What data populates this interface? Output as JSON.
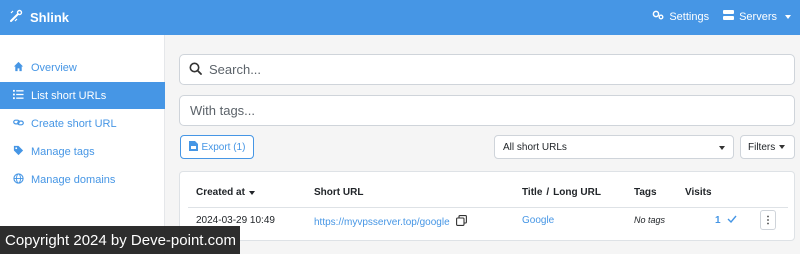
{
  "header": {
    "brand": "Shlink",
    "settings": "Settings",
    "servers": "Servers",
    "bar_color": "#4696e5"
  },
  "sidebar": {
    "items": [
      {
        "label": "Overview",
        "icon": "home-icon",
        "active": false
      },
      {
        "label": "List short URLs",
        "icon": "list-icon",
        "active": true
      },
      {
        "label": "Create short URL",
        "icon": "link-icon",
        "active": false
      },
      {
        "label": "Manage tags",
        "icon": "tags-icon",
        "active": false
      },
      {
        "label": "Manage domains",
        "icon": "globe-icon",
        "active": false
      }
    ]
  },
  "filters_bar": {
    "search_placeholder": "Search...",
    "tags_placeholder": "With tags...",
    "export_label": "Export (1)",
    "select_value": "All short URLs",
    "filters_label": "Filters"
  },
  "table": {
    "headers": {
      "created_at": "Created at",
      "short_url": "Short URL",
      "title": "Title",
      "separator": "/",
      "long_url": "Long URL",
      "tags": "Tags",
      "visits": "Visits"
    },
    "rows": [
      {
        "created_at": "2024-03-29 10:49",
        "short_url": "https://myvpsserver.top/google",
        "title": "Google",
        "tags": "No tags",
        "visits": "1",
        "menu": "⋮"
      }
    ]
  },
  "overlay": {
    "copyright": "Copyright 2024 by Deve-point.com"
  }
}
